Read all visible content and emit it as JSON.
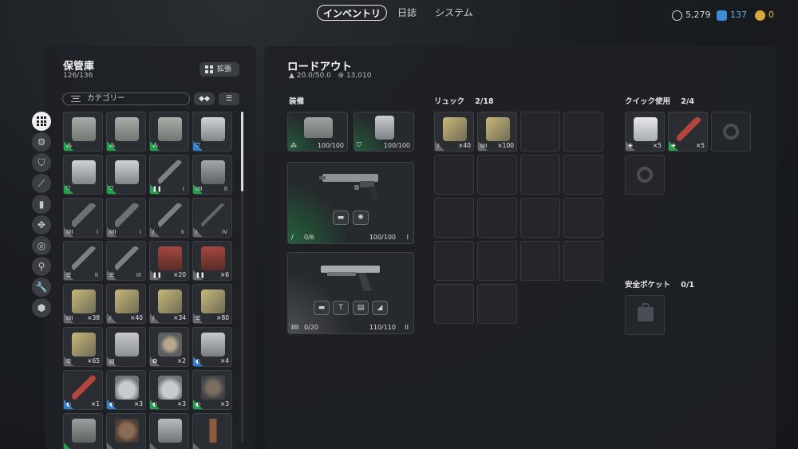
{
  "nav": {
    "tabs": [
      {
        "label": "インベントリ",
        "active": true
      },
      {
        "label": "日誌",
        "active": false
      },
      {
        "label": "システム",
        "active": false
      }
    ],
    "currencies": [
      {
        "icon": "coin-icon",
        "value": "5,279",
        "color": "#d8dadc"
      },
      {
        "icon": "premium-token-icon",
        "value": "137",
        "color": "#3d8ed8"
      },
      {
        "icon": "gold-token-icon",
        "value": "0",
        "color": "#d6a93a"
      }
    ]
  },
  "storage": {
    "title": "保管庫",
    "capacity": "126/136",
    "expand_label": "拡張",
    "search_placeholder": "カテゴリー",
    "sort_label": "◆◆",
    "filter_label": "☰",
    "items": [
      {
        "kind": "backpack",
        "rarity": "green",
        "tag": "⁂",
        "count": ""
      },
      {
        "kind": "backpack",
        "rarity": "green",
        "tag": "⁂",
        "count": ""
      },
      {
        "kind": "backpack",
        "rarity": "green",
        "tag": "⁂",
        "count": ""
      },
      {
        "kind": "armor",
        "rarity": "blue",
        "tag": "⛉",
        "count": ""
      },
      {
        "kind": "armor",
        "rarity": "green",
        "tag": "⛉",
        "count": ""
      },
      {
        "kind": "armor",
        "rarity": "green",
        "tag": "⛉",
        "count": ""
      },
      {
        "kind": "rifle",
        "rarity": "green",
        "tag": "❚❚",
        "count": "I"
      },
      {
        "kind": "pistol",
        "rarity": "green",
        "tag": "IIII",
        "count": "II"
      },
      {
        "kind": "smg",
        "rarity": "gray",
        "tag": "IIII",
        "count": "I"
      },
      {
        "kind": "smg",
        "rarity": "gray",
        "tag": "IIII",
        "count": "I"
      },
      {
        "kind": "rifle",
        "rarity": "gray",
        "tag": "/",
        "count": "II"
      },
      {
        "kind": "sniper",
        "rarity": "gray",
        "tag": "/",
        "count": "IV"
      },
      {
        "kind": "rifle",
        "rarity": "gray",
        "tag": "☰",
        "count": "II"
      },
      {
        "kind": "rifle",
        "rarity": "gray",
        "tag": "☰",
        "count": "III"
      },
      {
        "kind": "ammo-box",
        "rarity": "gray",
        "tag": "❚❚",
        "count": "×20"
      },
      {
        "kind": "ammo-box",
        "rarity": "gray",
        "tag": "❚❚",
        "count": "×6"
      },
      {
        "kind": "ammo",
        "rarity": "gray",
        "tag": "IIII",
        "count": "×38"
      },
      {
        "kind": "ammo",
        "rarity": "gray",
        "tag": "/",
        "count": "×40"
      },
      {
        "kind": "ammo",
        "rarity": "gray",
        "tag": "/",
        "count": "×34"
      },
      {
        "kind": "ammo",
        "rarity": "gray",
        "tag": "☰",
        "count": "×80"
      },
      {
        "kind": "ammo",
        "rarity": "gray",
        "tag": "☰",
        "count": "×65"
      },
      {
        "kind": "tube",
        "rarity": "gray",
        "tag": "▤",
        "count": ""
      },
      {
        "kind": "tool",
        "rarity": "gray",
        "tag": "✪",
        "count": "×2"
      },
      {
        "kind": "can",
        "rarity": "blue",
        "tag": "◐",
        "count": "×4"
      },
      {
        "kind": "injector",
        "rarity": "blue",
        "tag": "◐",
        "count": "×1"
      },
      {
        "kind": "flask",
        "rarity": "blue",
        "tag": "◐",
        "count": "×3"
      },
      {
        "kind": "flask",
        "rarity": "green",
        "tag": "◐",
        "count": "×3"
      },
      {
        "kind": "mine",
        "rarity": "green",
        "tag": "◐",
        "count": "×3"
      },
      {
        "kind": "device",
        "rarity": "green",
        "tag": "",
        "count": ""
      },
      {
        "kind": "grenade",
        "rarity": "gray",
        "tag": "",
        "count": ""
      },
      {
        "kind": "canister",
        "rarity": "gray",
        "tag": "",
        "count": ""
      },
      {
        "kind": "rod",
        "rarity": "gray",
        "tag": "",
        "count": ""
      }
    ]
  },
  "categories": [
    {
      "icon": "grid-all-icon",
      "active": true
    },
    {
      "icon": "backpack-icon",
      "active": false
    },
    {
      "icon": "shield-icon",
      "active": false
    },
    {
      "icon": "knife-icon",
      "active": false
    },
    {
      "icon": "ammo-icon",
      "active": false
    },
    {
      "icon": "trap-icon",
      "active": false
    },
    {
      "icon": "ring-icon",
      "active": false
    },
    {
      "icon": "tool-icon",
      "active": false
    },
    {
      "icon": "wrench-icon",
      "active": false
    },
    {
      "icon": "cube-icon",
      "active": false
    }
  ],
  "loadout": {
    "title": "ロードアウト",
    "weight": "20.0/50.0",
    "value": "13,010",
    "equipment_label": "装備",
    "backpack_slot": {
      "durability": "100/100",
      "tag": "⁂"
    },
    "armor_slot": {
      "durability": "100/100",
      "tag": "⛉"
    },
    "primary": {
      "ammo": "0/6",
      "durability": "100/100",
      "tier": "I",
      "ammo_tag": "/"
    },
    "secondary": {
      "ammo": "0/20",
      "durability": "110/110",
      "tier": "II",
      "ammo_tag": "IIII"
    },
    "backpack_label": "リュック",
    "backpack_count": "2/18",
    "backpack_items": [
      {
        "kind": "ammo",
        "tag": "/",
        "count": "×40"
      },
      {
        "kind": "ammo",
        "tag": "IIII",
        "count": "×100"
      }
    ],
    "quick_label": "クイック使用",
    "quick_count": "2/4",
    "quick_items": [
      {
        "kind": "bandage",
        "tag": "✚",
        "count": "×5"
      },
      {
        "kind": "injector",
        "tag": "✚",
        "count": "×5"
      }
    ],
    "safe_label": "安全ポケット",
    "safe_count": "0/1"
  },
  "colors": {
    "green": "#1fa34a",
    "blue": "#2f7fd6",
    "gray": "#666a70"
  }
}
